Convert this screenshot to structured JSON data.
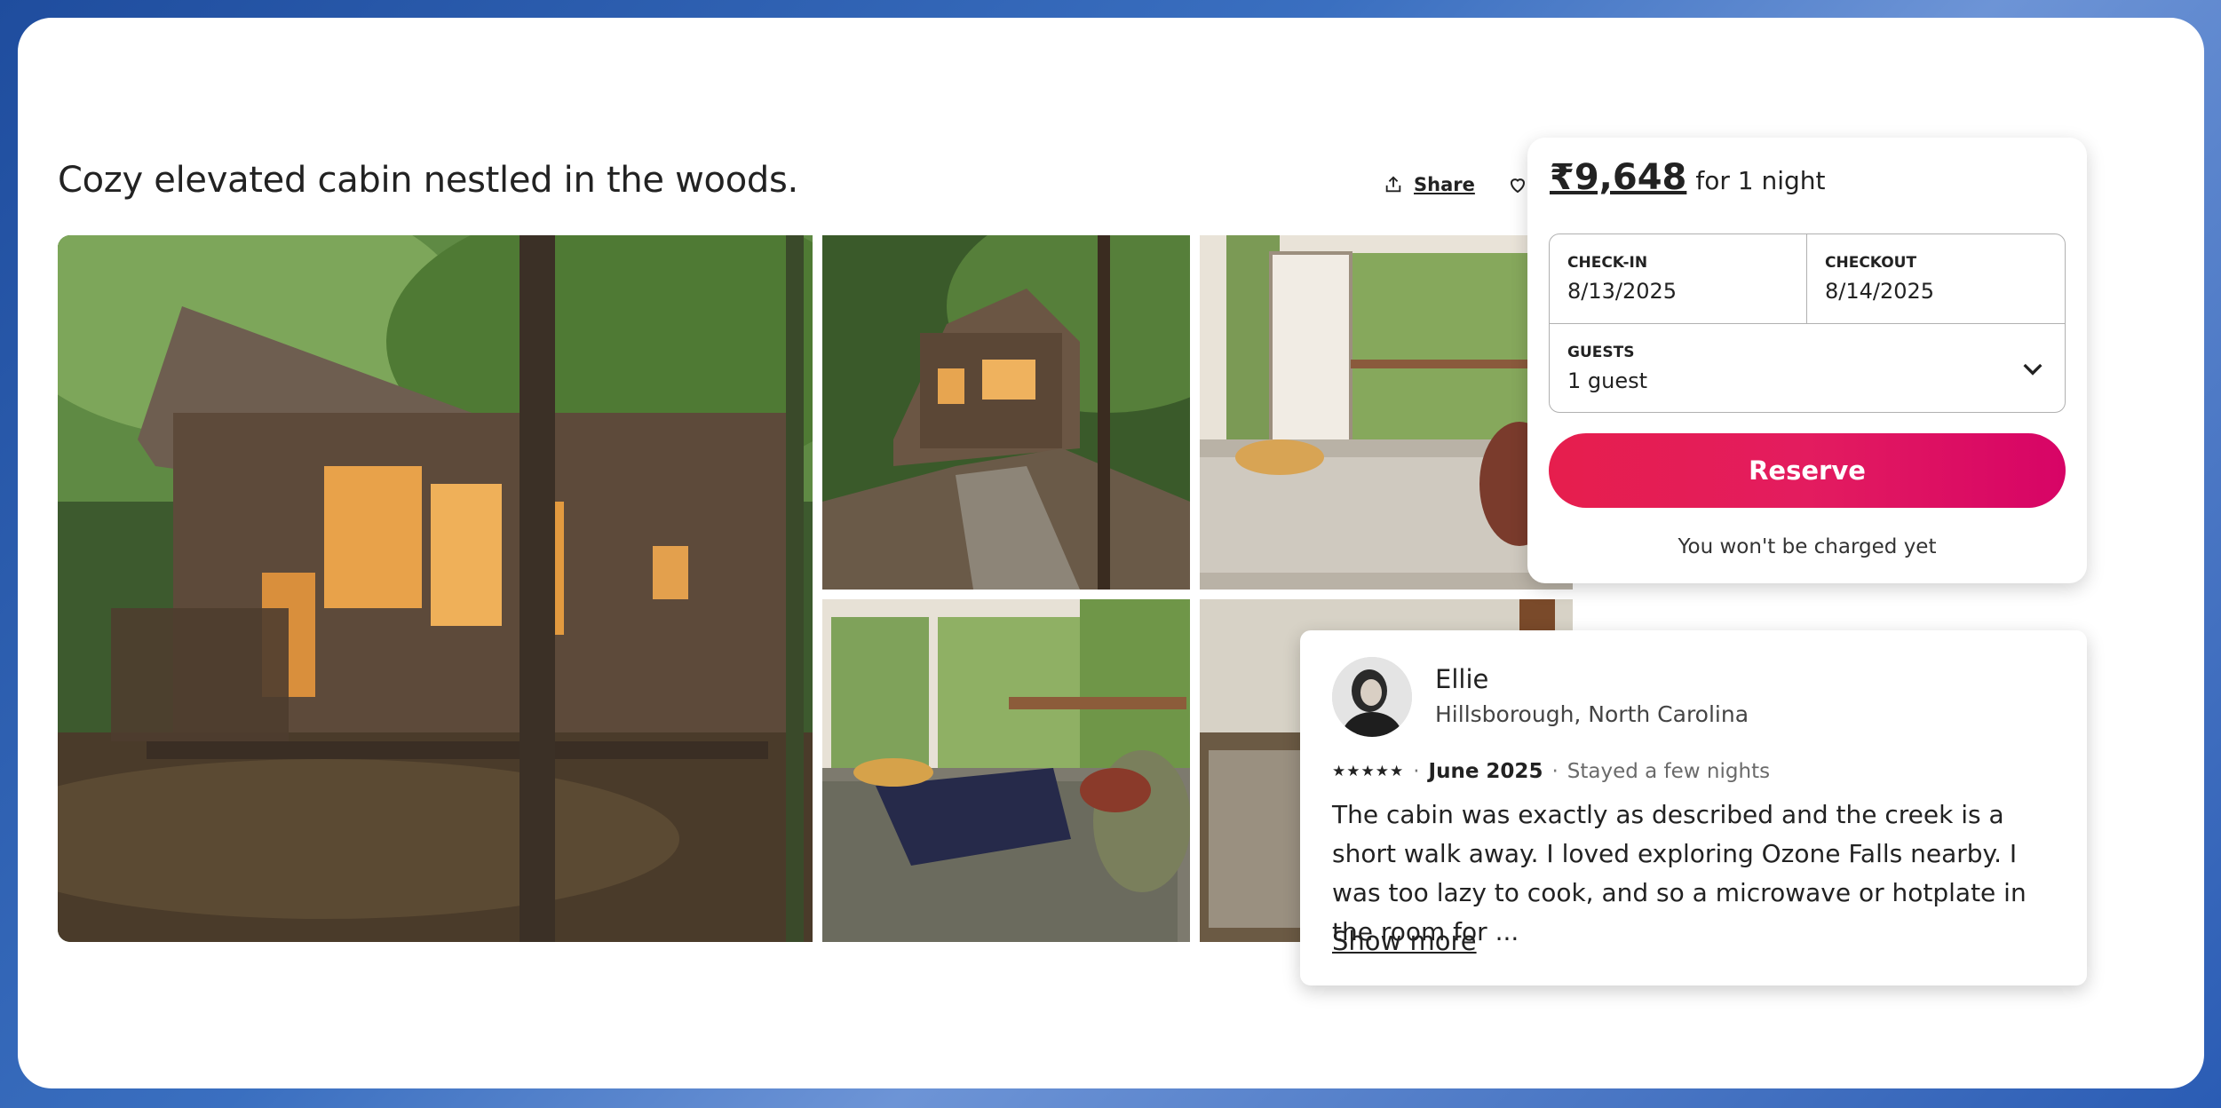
{
  "listing": {
    "title": "Cozy elevated cabin nestled in the woods.",
    "share_label": "Share",
    "share_icon": "share-icon",
    "save_icon": "heart-icon"
  },
  "photos": [
    {
      "name": "cabin-exterior-photo"
    },
    {
      "name": "cabin-path-photo"
    },
    {
      "name": "cabin-interior-door-photo"
    },
    {
      "name": "cabin-bedroom-photo"
    },
    {
      "name": "cabin-deck-photo"
    }
  ],
  "booking": {
    "price": "₹9,648",
    "per": "for 1 night",
    "checkin_label": "CHECK-IN",
    "checkin_value": "8/13/2025",
    "checkout_label": "CHECKOUT",
    "checkout_value": "8/14/2025",
    "guests_label": "GUESTS",
    "guests_value": "1 guest",
    "reserve_label": "Reserve",
    "note": "You won't be charged yet",
    "accent_color": "#e31c5f"
  },
  "review": {
    "name": "Ellie",
    "location": "Hillsborough, North Carolina",
    "stars": "★★★★★",
    "rating": 5,
    "date": "June 2025",
    "separator": "·",
    "stay": "Stayed a few nights",
    "text": "The cabin was exactly as described and the creek is a short walk away. I loved exploring Ozone Falls nearby. I was too lazy to cook, and so a microwave or hotplate in the room for ...",
    "show_more": "Show more"
  }
}
